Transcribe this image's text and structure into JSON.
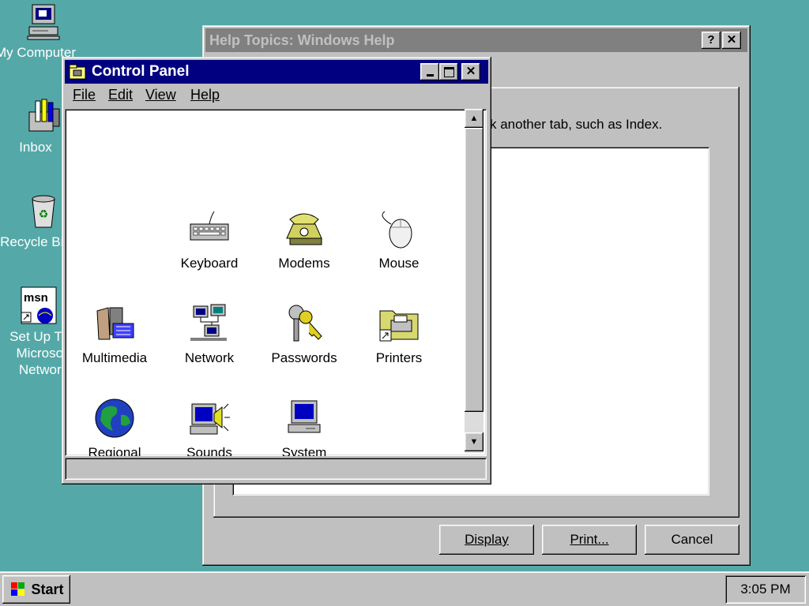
{
  "desktop": {
    "icons": [
      {
        "label": "My Computer",
        "icon": "my-computer-icon"
      },
      {
        "label": "Inbox",
        "icon": "inbox-icon"
      },
      {
        "label": "Recycle Bin",
        "icon": "recycle-bin-icon"
      },
      {
        "label": "Set Up The Microsoft Network",
        "icon": "msn-icon"
      }
    ]
  },
  "help_window": {
    "title": "Help Topics: Windows Help",
    "body_text": "k another tab, such as Index.",
    "buttons": {
      "display": "Display",
      "print": "Print...",
      "cancel": "Cancel"
    },
    "help_btn": "?",
    "close_btn": "✕"
  },
  "control_panel": {
    "title": "Control Panel",
    "menu": {
      "file": "File",
      "edit": "Edit",
      "view": "View",
      "help": "Help"
    },
    "items": [
      {
        "label": "Keyboard",
        "icon": "keyboard-icon"
      },
      {
        "label": "Modems",
        "icon": "modem-telephone-icon"
      },
      {
        "label": "Mouse",
        "icon": "mouse-icon"
      },
      {
        "label": "Multimedia",
        "icon": "multimedia-icon"
      },
      {
        "label": "Network",
        "icon": "network-icon"
      },
      {
        "label": "Passwords",
        "icon": "keys-icon"
      },
      {
        "label": "Printers",
        "icon": "printer-folder-icon"
      },
      {
        "label": "Regional",
        "icon": "globe-icon"
      },
      {
        "label": "Sounds",
        "icon": "speaker-computer-icon"
      },
      {
        "label": "System",
        "icon": "computer-icon"
      }
    ]
  },
  "taskbar": {
    "start_label": "Start",
    "clock": "3:05 PM"
  },
  "colors": {
    "desktop": "#55a8a8",
    "active_title": "#000080",
    "inactive_title": "#808080",
    "face": "#c0c0c0"
  }
}
